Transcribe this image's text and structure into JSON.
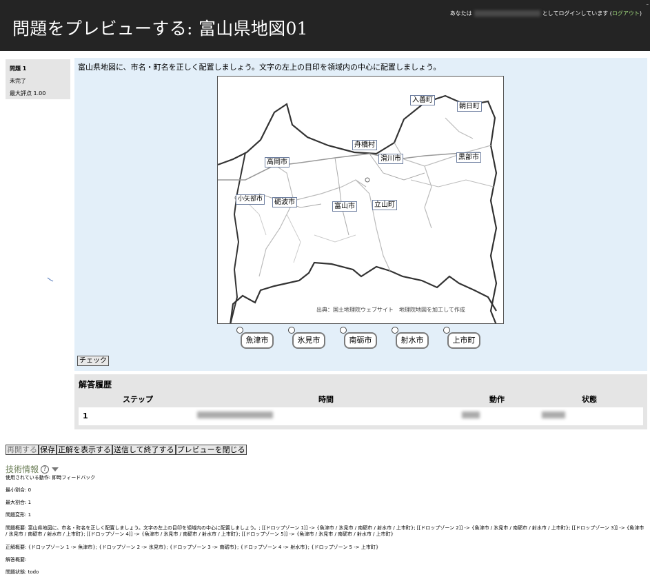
{
  "header": {
    "title": "問題をプレビューする: 富山県地図01",
    "login_prefix": "あなたは",
    "login_suffix": "としてログインしています (",
    "logout": "ログアウト",
    "login_close": ")"
  },
  "info": {
    "question_no": "問題 1",
    "status": "未完了",
    "max_mark": "最大評点 1.00"
  },
  "question": {
    "text": "富山県地図に、市名・町名を正しく配置しましょう。文字の左上の目印を領域内の中心に配置しましょう。",
    "map_labels": [
      "入善町",
      "朝日町",
      "舟橋村",
      "滑川市",
      "黒部市",
      "高岡市",
      "小矢部市",
      "砺波市",
      "富山市",
      "立山町"
    ],
    "map_credit": "出典：国土地理院ウェブサイト　地理院地図を加工して作成",
    "drag_items": [
      "魚津市",
      "氷見市",
      "南砺市",
      "射水市",
      "上市町"
    ],
    "check_label": "チェック"
  },
  "history": {
    "title": "解答履歴",
    "columns": [
      "ステップ",
      "時間",
      "動作",
      "状態"
    ],
    "rows": [
      {
        "step": "1"
      }
    ]
  },
  "actions": {
    "restart": "再開する",
    "save": "保存",
    "show_correct": "正解を表示する",
    "submit": "送信して終了する",
    "close": "プレビューを閉じる"
  },
  "tech": {
    "title": "技術情報",
    "behaviour": "使用されている動作: 即時フィードバック",
    "min_fraction": "最小割合: 0",
    "max_fraction": "最大割合: 1",
    "variant": "問題変形: 1",
    "summary": "問題概要: 富山県地図に、市名・町名を正しく配置しましょう。文字の左上の目印を領域内の中心に配置しましょう。; [[ドロップゾーン 1]] -> {魚津市 / 氷見市 / 南砺市 / 射水市 / 上市町}; [[ドロップゾーン 2]] -> {魚津市 / 氷見市 / 南砺市 / 射水市 / 上市町}; [[ドロップゾーン 3]] -> {魚津市 / 氷見市 / 南砺市 / 射水市 / 上市町}; [[ドロップゾーン 4]] -> {魚津市 / 氷見市 / 南砺市 / 射水市 / 上市町}; [[ドロップゾーン 5]] -> {魚津市 / 氷見市 / 南砺市 / 射水市 / 上市町}",
    "right_answer": "正解概要: {ドロップゾーン 1 -> 魚津市}; {ドロップゾーン 2 -> 氷見市}; {ドロップゾーン 3 -> 南砺市}; {ドロップゾーン 4 -> 射水市}; {ドロップゾーン 5 -> 上市町}",
    "response": "解答概要:",
    "state": "問題状態: todo"
  }
}
